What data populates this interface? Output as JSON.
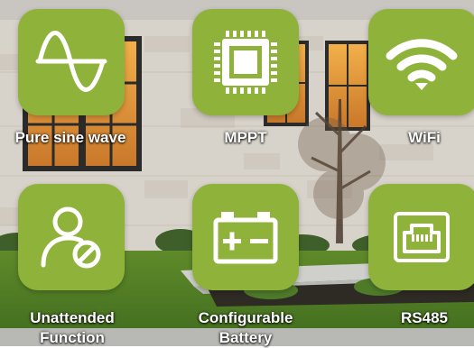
{
  "features": [
    {
      "label": "Pure sine wave",
      "icon": "sine-wave-icon"
    },
    {
      "label": "MPPT",
      "icon": "chip-icon"
    },
    {
      "label": "WiFi",
      "icon": "wifi-icon"
    },
    {
      "label": "Unattended Function",
      "icon": "user-block-icon"
    },
    {
      "label": "Configurable Battery",
      "icon": "battery-icon"
    },
    {
      "label": "RS485",
      "icon": "ethernet-port-icon"
    }
  ],
  "colors": {
    "tile": "#8fb33a",
    "icon": "#ffffff",
    "label": "#ffffff"
  }
}
